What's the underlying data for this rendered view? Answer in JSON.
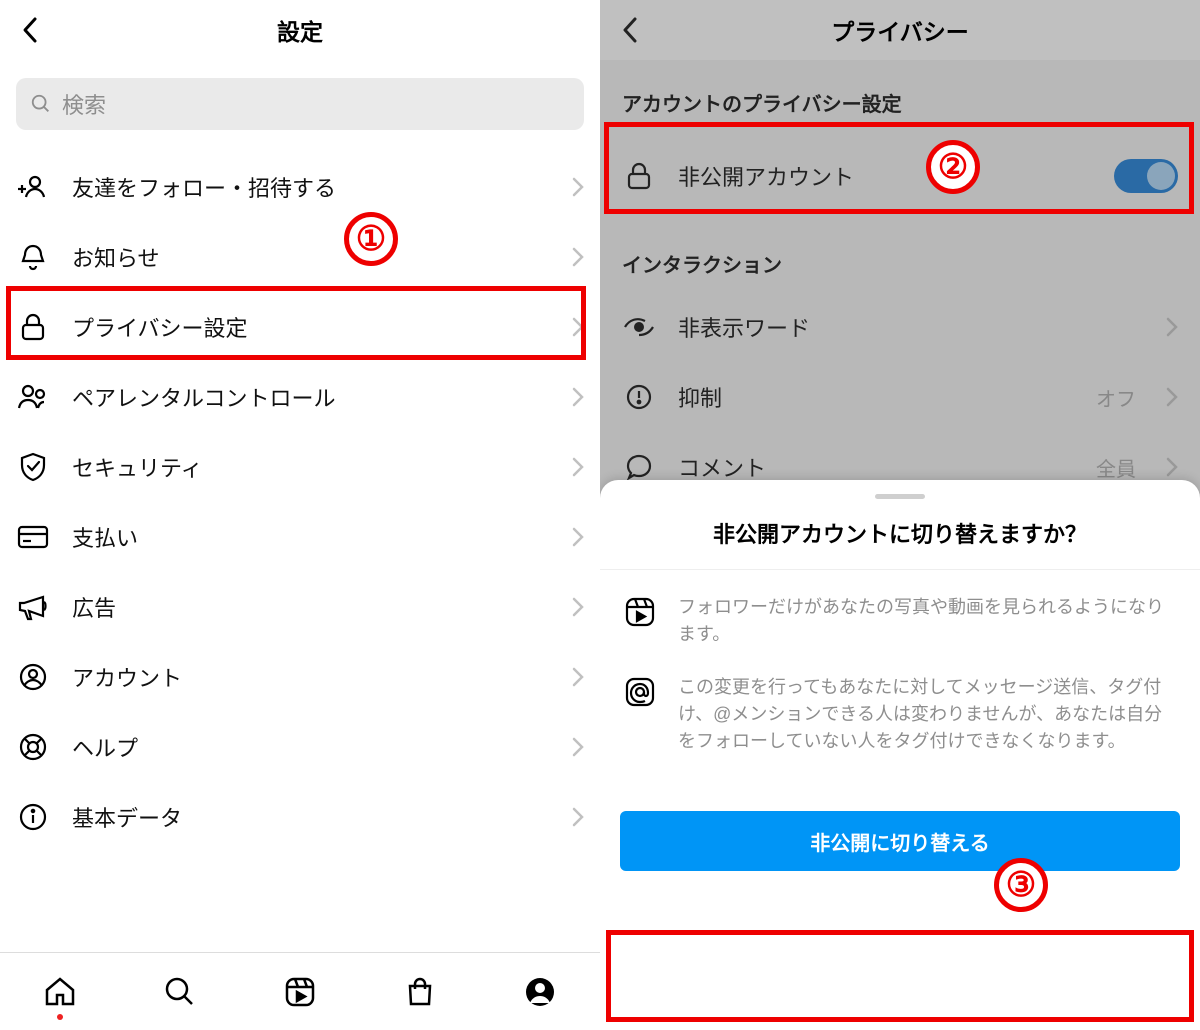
{
  "left": {
    "title": "設定",
    "search_placeholder": "検索",
    "items": [
      {
        "label": "友達をフォロー・招待する"
      },
      {
        "label": "お知らせ"
      },
      {
        "label": "プライバシー設定"
      },
      {
        "label": "ペアレンタルコントロール"
      },
      {
        "label": "セキュリティ"
      },
      {
        "label": "支払い"
      },
      {
        "label": "広告"
      },
      {
        "label": "アカウント"
      },
      {
        "label": "ヘルプ"
      },
      {
        "label": "基本データ"
      }
    ]
  },
  "right": {
    "title": "プライバシー",
    "section1": "アカウントのプライバシー設定",
    "private_account_label": "非公開アカウント",
    "section2": "インタラクション",
    "interaction_items": [
      {
        "label": "非表示ワード",
        "value": ""
      },
      {
        "label": "抑制",
        "value": "オフ"
      },
      {
        "label": "コメント",
        "value": "全員"
      }
    ],
    "sheet": {
      "title": "非公開アカウントに切り替えますか？",
      "desc1": "フォロワーだけがあなたの写真や動画を見られるようになります。",
      "desc2": "この変更を行ってもあなたに対してメッセージ送信、タグ付け、@メンションできる人は変わりませんが、あなたは自分をフォローしていない人をタグ付けできなくなります。",
      "button": "非公開に切り替える"
    }
  },
  "callouts": {
    "n1": "①",
    "n2": "②",
    "n3": "③"
  }
}
